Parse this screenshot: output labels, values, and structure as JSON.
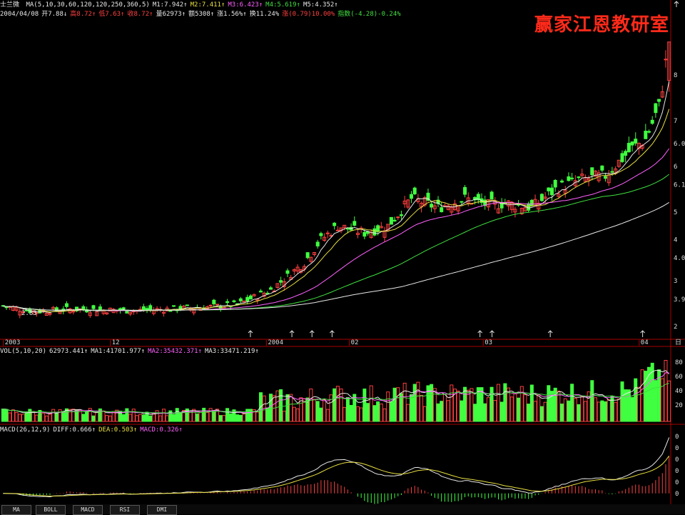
{
  "stock_name": "士兰微",
  "header": {
    "ma_line": [
      {
        "text": "MA(5,10,30,60,120,120,250,360,5)",
        "color": "#e8e8e8"
      },
      {
        "text": "M1:7.942↑",
        "color": "#e8e8e8"
      },
      {
        "text": "M2:7.411↑",
        "color": "#e8e040"
      },
      {
        "text": "M3:6.423↑",
        "color": "#ff60ff"
      },
      {
        "text": "M4:5.619↑",
        "color": "#40e040"
      },
      {
        "text": "M5:4.352↑",
        "color": "#e8e8e8"
      }
    ],
    "quote_line": [
      {
        "text": "2004/04/08",
        "color": "#e8e8e8"
      },
      {
        "text": "开7.88↓",
        "color": "#e8e8e8"
      },
      {
        "text": "高8.72↑",
        "color": "#ff4040"
      },
      {
        "text": "低7.63↑",
        "color": "#ff4040"
      },
      {
        "text": "收8.72↑",
        "color": "#ff4040"
      },
      {
        "text": "量62973↑",
        "color": "#e8e8e8"
      },
      {
        "text": "额5308↑",
        "color": "#e8e8e8"
      },
      {
        "text": "涨1.56%↑",
        "color": "#e8e8e8"
      },
      {
        "text": "换11.24%",
        "color": "#e8e8e8"
      },
      {
        "text": "涨(0.79)10.00%",
        "color": "#ff4040"
      },
      {
        "text": "指数(-4.28)-0.24%",
        "color": "#40e040"
      }
    ]
  },
  "watermark": "赢家江恩教研室",
  "low_marker": "2.83",
  "time_axis": [
    {
      "label": "2003",
      "pos": 0.005
    },
    {
      "label": "12",
      "pos": 0.165
    },
    {
      "label": "2004",
      "pos": 0.398
    },
    {
      "label": "02",
      "pos": 0.522
    },
    {
      "label": "03",
      "pos": 0.722
    },
    {
      "label": "04",
      "pos": 0.955
    }
  ],
  "event_markers": [
    0.372,
    0.434,
    0.464,
    0.494,
    0.715,
    0.733,
    0.82,
    0.958
  ],
  "price_labels": [
    {
      "label": "8",
      "price": 8.0
    },
    {
      "label": "7",
      "price": 7.0
    },
    {
      "label": "6.0",
      "price": 6.5
    },
    {
      "label": "6",
      "price": 6.0
    },
    {
      "label": "6.1",
      "price": 5.6
    },
    {
      "label": "5",
      "price": 5.0
    },
    {
      "label": "4",
      "price": 4.4
    },
    {
      "label": "4.0",
      "price": 4.0
    },
    {
      "label": "3",
      "price": 3.5
    },
    {
      "label": "3.9",
      "price": 3.1
    },
    {
      "label": "2",
      "price": 2.5
    }
  ],
  "volume_header": [
    {
      "text": "VOL(5,10,20)",
      "color": "#e8e8e8"
    },
    {
      "text": "62973.441↑",
      "color": "#e8e8e8"
    },
    {
      "text": "MA1:41701.977↑",
      "color": "#e8e8e8"
    },
    {
      "text": "MA2:35432.371↑",
      "color": "#ff60ff"
    },
    {
      "text": "MA3:33471.219↑",
      "color": "#e8e8e8"
    }
  ],
  "volume_labels": [
    "80",
    "60",
    "40",
    "20"
  ],
  "macd_header": [
    {
      "text": "MACD(26,12,9)",
      "color": "#e8e8e8"
    },
    {
      "text": "DIFF:0.666↑",
      "color": "#e8e8e8"
    },
    {
      "text": "DEA:0.503↑",
      "color": "#e8e040"
    },
    {
      "text": "MACD:0.326↑",
      "color": "#ff60ff"
    }
  ],
  "macd_labels": [
    "0",
    "0",
    "0",
    "0",
    "0",
    "0"
  ],
  "tabs": [
    "MA",
    "BOLL",
    "MACD",
    "RSI",
    "DMI"
  ],
  "side_label": "日",
  "chart_data": {
    "type": "candlestick",
    "period": "daily",
    "date_range": [
      "2003",
      "2004/04/08"
    ],
    "price_low": 2.83,
    "last_close": 8.72,
    "keypoints_close": [
      {
        "i": 0,
        "v": 2.95
      },
      {
        "i": 5,
        "v": 2.88
      },
      {
        "i": 10,
        "v": 2.83
      },
      {
        "i": 20,
        "v": 2.88
      },
      {
        "i": 40,
        "v": 2.85
      },
      {
        "i": 60,
        "v": 2.92
      },
      {
        "i": 70,
        "v": 2.98
      },
      {
        "i": 80,
        "v": 3.3
      },
      {
        "i": 90,
        "v": 3.9
      },
      {
        "i": 95,
        "v": 4.4
      },
      {
        "i": 100,
        "v": 4.7
      },
      {
        "i": 108,
        "v": 4.55
      },
      {
        "i": 115,
        "v": 4.7
      },
      {
        "i": 122,
        "v": 5.3
      },
      {
        "i": 130,
        "v": 5.1
      },
      {
        "i": 138,
        "v": 5.3
      },
      {
        "i": 145,
        "v": 5.15
      },
      {
        "i": 150,
        "v": 5.2
      },
      {
        "i": 158,
        "v": 5.1
      },
      {
        "i": 165,
        "v": 5.5
      },
      {
        "i": 172,
        "v": 5.7
      },
      {
        "i": 180,
        "v": 5.8
      },
      {
        "i": 188,
        "v": 6.4
      },
      {
        "i": 192,
        "v": 6.6
      },
      {
        "i": 196,
        "v": 7.3
      },
      {
        "i": 199,
        "v": 8.72
      }
    ],
    "moving_averages": [
      {
        "name": "M1",
        "last": 7.942,
        "color": "#e8e8e8"
      },
      {
        "name": "M2",
        "last": 7.411,
        "color": "#e8e040"
      },
      {
        "name": "M3",
        "last": 6.423,
        "color": "#ff60ff"
      },
      {
        "name": "M4",
        "last": 5.619,
        "color": "#40e040"
      },
      {
        "name": "M5",
        "last": 4.352,
        "color": "#e8e8e8"
      }
    ],
    "volume": {
      "last": 62973.441,
      "ma1": 41701.977,
      "ma2": 35432.371,
      "ma3": 33471.219
    },
    "macd": {
      "diff": 0.666,
      "dea": 0.503,
      "macd": 0.326
    }
  }
}
